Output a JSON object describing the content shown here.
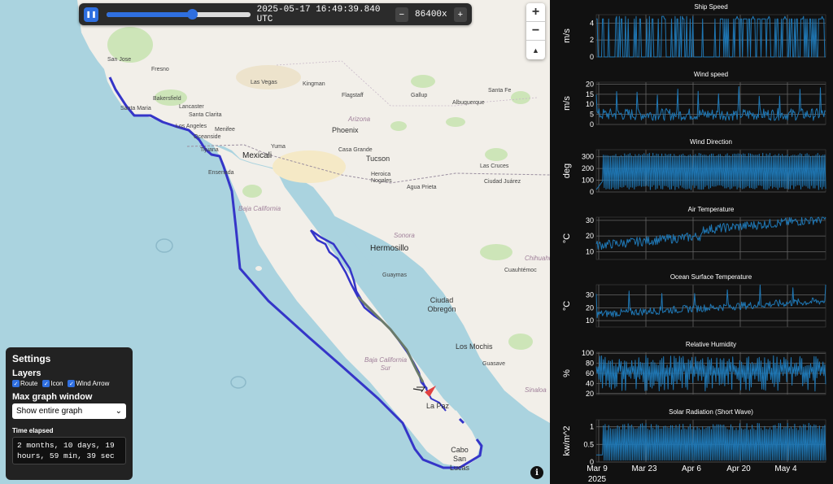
{
  "playback": {
    "pause_icon": "pause-icon",
    "progress": 0.54,
    "time": "2025-05-17 16:49:39.840 UTC",
    "decrease_label": "−",
    "speed": "86400x",
    "increase_label": "+"
  },
  "zoom": {
    "in": "+",
    "out": "−",
    "compass": "▲"
  },
  "info_label": "i",
  "settings": {
    "title": "Settings",
    "layers_title": "Layers",
    "layers": [
      {
        "label": "Route",
        "checked": true
      },
      {
        "label": "Icon",
        "checked": true
      },
      {
        "label": "Wind Arrow",
        "checked": true
      }
    ],
    "max_graph_title": "Max graph window",
    "max_graph_value": "Show entire graph",
    "elapsed_label": "Time elapsed",
    "elapsed_value": "2 months, 10 days, 19 hours, 59 min, 39 sec"
  },
  "map_labels": [
    {
      "text": "San Jose",
      "cls": "ml-city"
    },
    {
      "text": "Fresno",
      "cls": "ml-city"
    },
    {
      "text": "Las Vegas",
      "cls": "ml-city"
    },
    {
      "text": "Bakersfield",
      "cls": "ml-city"
    },
    {
      "text": "Lancaster",
      "cls": "ml-city"
    },
    {
      "text": "Kingman",
      "cls": "ml-city"
    },
    {
      "text": "Flagstaff",
      "cls": "ml-city"
    },
    {
      "text": "Gallup",
      "cls": "ml-city"
    },
    {
      "text": "Santa Fe",
      "cls": "ml-city"
    },
    {
      "text": "Albuquerque",
      "cls": "ml-city"
    },
    {
      "text": "Santa Maria",
      "cls": "ml-city"
    },
    {
      "text": "Santa Clarita",
      "cls": "ml-city"
    },
    {
      "text": "Los Angeles",
      "cls": "ml-city"
    },
    {
      "text": "Menifee",
      "cls": "ml-city"
    },
    {
      "text": "Oceanside",
      "cls": "ml-city"
    },
    {
      "text": "Arizona",
      "cls": "ml-state"
    },
    {
      "text": "Phoenix",
      "cls": "ml-big"
    },
    {
      "text": "Tijuana",
      "cls": "ml-city"
    },
    {
      "text": "Mexicali",
      "cls": "ml-bigcity"
    },
    {
      "text": "Yuma",
      "cls": "ml-city"
    },
    {
      "text": "Casa Grande",
      "cls": "ml-city"
    },
    {
      "text": "Tucson",
      "cls": "ml-big"
    },
    {
      "text": "Las Cruces",
      "cls": "ml-city"
    },
    {
      "text": "Ensenada",
      "cls": "ml-city"
    },
    {
      "text": "Heroica Nogales",
      "cls": "ml-city"
    },
    {
      "text": "Agua Prieta",
      "cls": "ml-city"
    },
    {
      "text": "Ciudad Juárez",
      "cls": "ml-city"
    },
    {
      "text": "Baja California",
      "cls": "ml-state"
    },
    {
      "text": "Sonora",
      "cls": "ml-state"
    },
    {
      "text": "Hermosillo",
      "cls": "ml-bigcity"
    },
    {
      "text": "Chihuahua",
      "cls": "ml-state"
    },
    {
      "text": "Guaymas",
      "cls": "ml-city"
    },
    {
      "text": "Cuauhtémoc",
      "cls": "ml-city"
    },
    {
      "text": "Ciudad Obregón",
      "cls": "ml-big"
    },
    {
      "text": "Los Mochis",
      "cls": "ml-big"
    },
    {
      "text": "Baja California Sur",
      "cls": "ml-state"
    },
    {
      "text": "Guasave",
      "cls": "ml-city"
    },
    {
      "text": "Sinaloa",
      "cls": "ml-state"
    },
    {
      "text": "La Paz",
      "cls": "ml-big"
    },
    {
      "text": "Cabo San Lucas",
      "cls": "ml-big"
    }
  ],
  "chart_data": [
    {
      "type": "line",
      "title": "Ship Speed",
      "ylabel": "m/s",
      "yticks": [
        0,
        2,
        4
      ],
      "ylim": [
        0,
        5
      ],
      "x_range": [
        "2025-03-05",
        "2025-05-17"
      ],
      "color": "#1f77b4",
      "description_values": "intermittent 0 to ~5 m/s bursts, dense after Apr 10"
    },
    {
      "type": "line",
      "title": "Wind speed",
      "ylabel": "m/s",
      "yticks": [
        0,
        5,
        10,
        15,
        20
      ],
      "ylim": [
        0,
        21
      ],
      "color": "#1f77b4"
    },
    {
      "type": "line",
      "title": "Wind Direction",
      "ylabel": "deg",
      "yticks": [
        0,
        100,
        200,
        300
      ],
      "ylim": [
        0,
        360
      ],
      "color": "#1f77b4"
    },
    {
      "type": "line",
      "title": "Air Temperature",
      "ylabel": "°C",
      "yticks": [
        10,
        20,
        30
      ],
      "ylim": [
        5,
        32
      ],
      "color": "#1f77b4"
    },
    {
      "type": "line",
      "title": "Ocean Surface Temperature",
      "ylabel": "°C",
      "yticks": [
        10,
        20,
        30
      ],
      "ylim": [
        5,
        38
      ],
      "color": "#1f77b4"
    },
    {
      "type": "line",
      "title": "Relative Humidity",
      "ylabel": "%",
      "yticks": [
        20,
        40,
        60,
        80,
        100
      ],
      "ylim": [
        18,
        102
      ],
      "color": "#1f77b4"
    },
    {
      "type": "line",
      "title": "Solar Radiation (Short Wave)",
      "ylabel": "kw/m^2",
      "yticks": [
        0,
        0.5,
        1
      ],
      "ylim": [
        0,
        1.2
      ],
      "color": "#1f77b4"
    }
  ],
  "x_axis": {
    "ticks": [
      "Mar 9",
      "Mar 23",
      "Apr 6",
      "Apr 20",
      "May 4"
    ],
    "year": "2025"
  }
}
